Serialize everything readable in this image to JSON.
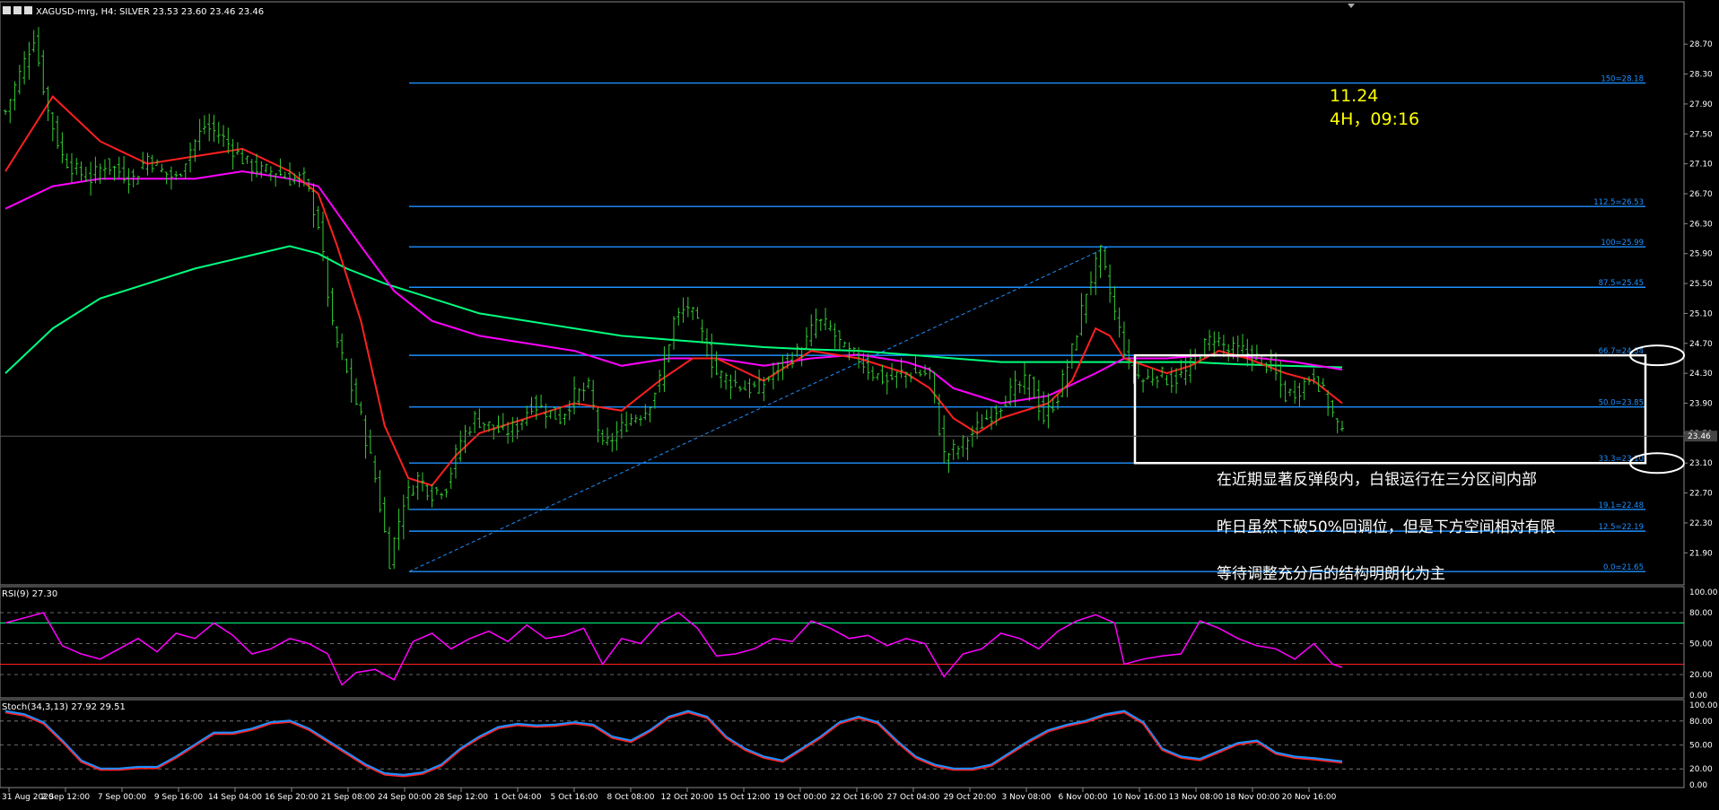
{
  "header": {
    "title": "XAGUSD-mrg, H4:  SILVER  23.53 23.60 23.46 23.46"
  },
  "note": {
    "line1": "11.24",
    "line2": "4H，09:16"
  },
  "annotations": [
    "在近期显著反弹段内，白银运行在三分区间内部",
    "昨日虽然下破50%回调位，但是下方空间相对有限",
    "等待调整充分后的结构明朗化为主"
  ],
  "price_axis": {
    "ticks": [
      "28.70",
      "28.30",
      "27.90",
      "27.50",
      "27.10",
      "26.70",
      "26.30",
      "25.90",
      "25.50",
      "25.10",
      "24.70",
      "24.30",
      "23.90",
      "23.50",
      "23.10",
      "22.70",
      "22.30",
      "21.90"
    ],
    "current": "23.46"
  },
  "x_axis": {
    "ticks": [
      "31 Aug 2020",
      "2 Sep 12:00",
      "7 Sep 00:00",
      "9 Sep 16:00",
      "14 Sep 04:00",
      "16 Sep 20:00",
      "21 Sep 08:00",
      "24 Sep 00:00",
      "28 Sep 12:00",
      "1 Oct 04:00",
      "5 Oct 16:00",
      "8 Oct 08:00",
      "12 Oct 20:00",
      "15 Oct 12:00",
      "19 Oct 00:00",
      "22 Oct 16:00",
      "27 Oct 04:00",
      "29 Oct 20:00",
      "3 Nov 08:00",
      "6 Nov 00:00",
      "10 Nov 16:00",
      "13 Nov 08:00",
      "18 Nov 00:00",
      "20 Nov 16:00"
    ]
  },
  "rsi": {
    "title": "RSI(9) 27.30",
    "ticks": [
      "100.00",
      "80.00",
      "50.00",
      "20.00",
      "0.00"
    ]
  },
  "stoch": {
    "title": "Stoch(34,3,13) 27.92 29.51",
    "ticks": [
      "100.00",
      "80.00",
      "50.00",
      "20.00",
      "0.00"
    ]
  },
  "colors": {
    "bg": "#000000",
    "candle": "#33cc33",
    "fib": "#1e90ff",
    "ma_fast": "#ff2020",
    "ma_mid": "#ff00ff",
    "ma_slow": "#00ff7f",
    "rsi": "#ff00ff",
    "stoch_main": "#1e90ff",
    "stoch_signal": "#ff2020",
    "text": "#ffffff",
    "note": "#ffff00"
  },
  "chart_data": {
    "type": "line",
    "price_range": [
      21.52,
      29.05
    ],
    "fib_levels": [
      {
        "label": "150=28.18",
        "value": 28.18
      },
      {
        "label": "112.5=26.53",
        "value": 26.53
      },
      {
        "label": "100=25.99",
        "value": 25.99
      },
      {
        "label": "87.5=25.45",
        "value": 25.45
      },
      {
        "label": "66.7=24.54",
        "value": 24.54
      },
      {
        "label": "50.0=23.85",
        "value": 23.85
      },
      {
        "label": "33.3=23.10",
        "value": 23.1
      },
      {
        "label": "19.1=22.48",
        "value": 22.48
      },
      {
        "label": "12.5=22.19",
        "value": 22.19
      },
      {
        "label": "0.0=21.65",
        "value": 21.65
      }
    ],
    "close": [
      [
        0,
        27.8
      ],
      [
        3,
        28.3
      ],
      [
        6,
        28.8
      ],
      [
        9,
        27.8
      ],
      [
        12,
        27.2
      ],
      [
        15,
        27.0
      ],
      [
        18,
        26.9
      ],
      [
        21,
        27.1
      ],
      [
        24,
        27.0
      ],
      [
        27,
        26.9
      ],
      [
        30,
        27.2
      ],
      [
        33,
        27.0
      ],
      [
        36,
        26.9
      ],
      [
        39,
        27.3
      ],
      [
        42,
        27.6
      ],
      [
        45,
        27.5
      ],
      [
        48,
        27.3
      ],
      [
        51,
        27.1
      ],
      [
        54,
        27.0
      ],
      [
        57,
        27.0
      ],
      [
        60,
        26.9
      ],
      [
        63,
        26.9
      ],
      [
        66,
        26.3
      ],
      [
        69,
        24.9
      ],
      [
        72,
        24.3
      ],
      [
        75,
        23.7
      ],
      [
        78,
        22.9
      ],
      [
        81,
        21.8
      ],
      [
        84,
        22.6
      ],
      [
        87,
        22.9
      ],
      [
        90,
        22.7
      ],
      [
        93,
        22.8
      ],
      [
        96,
        23.4
      ],
      [
        99,
        23.7
      ],
      [
        102,
        23.6
      ],
      [
        105,
        23.5
      ],
      [
        108,
        23.6
      ],
      [
        111,
        23.9
      ],
      [
        114,
        23.8
      ],
      [
        117,
        23.7
      ],
      [
        120,
        24.0
      ],
      [
        123,
        24.1
      ],
      [
        126,
        23.3
      ],
      [
        129,
        23.5
      ],
      [
        132,
        23.7
      ],
      [
        135,
        23.8
      ],
      [
        138,
        24.2
      ],
      [
        141,
        25.0
      ],
      [
        144,
        25.2
      ],
      [
        147,
        24.8
      ],
      [
        150,
        24.3
      ],
      [
        153,
        24.2
      ],
      [
        156,
        24.1
      ],
      [
        159,
        24.1
      ],
      [
        162,
        24.3
      ],
      [
        165,
        24.5
      ],
      [
        168,
        24.6
      ],
      [
        171,
        25.0
      ],
      [
        174,
        24.9
      ],
      [
        177,
        24.6
      ],
      [
        180,
        24.5
      ],
      [
        183,
        24.3
      ],
      [
        186,
        24.2
      ],
      [
        189,
        24.3
      ],
      [
        192,
        24.3
      ],
      [
        195,
        24.3
      ],
      [
        198,
        23.2
      ],
      [
        201,
        23.3
      ],
      [
        204,
        23.5
      ],
      [
        207,
        23.7
      ],
      [
        210,
        23.9
      ],
      [
        213,
        24.1
      ],
      [
        216,
        24.2
      ],
      [
        219,
        23.7
      ],
      [
        222,
        24.0
      ],
      [
        225,
        24.6
      ],
      [
        228,
        25.4
      ],
      [
        231,
        25.9
      ],
      [
        234,
        25.1
      ],
      [
        237,
        24.4
      ],
      [
        240,
        24.2
      ],
      [
        243,
        24.3
      ],
      [
        246,
        24.2
      ],
      [
        249,
        24.3
      ],
      [
        252,
        24.6
      ],
      [
        255,
        24.8
      ],
      [
        258,
        24.6
      ],
      [
        261,
        24.6
      ],
      [
        264,
        24.5
      ],
      [
        267,
        24.4
      ],
      [
        270,
        24.0
      ],
      [
        273,
        24.1
      ],
      [
        276,
        24.3
      ],
      [
        279,
        23.9
      ],
      [
        282,
        23.46
      ]
    ],
    "ma_fast": [
      [
        0,
        27.0
      ],
      [
        10,
        28.0
      ],
      [
        20,
        27.4
      ],
      [
        30,
        27.1
      ],
      [
        40,
        27.2
      ],
      [
        50,
        27.3
      ],
      [
        60,
        27.0
      ],
      [
        66,
        26.7
      ],
      [
        70,
        26.0
      ],
      [
        75,
        25.0
      ],
      [
        80,
        23.6
      ],
      [
        85,
        22.9
      ],
      [
        90,
        22.8
      ],
      [
        95,
        23.2
      ],
      [
        100,
        23.5
      ],
      [
        110,
        23.7
      ],
      [
        120,
        23.9
      ],
      [
        130,
        23.8
      ],
      [
        138,
        24.2
      ],
      [
        145,
        24.5
      ],
      [
        150,
        24.5
      ],
      [
        160,
        24.2
      ],
      [
        170,
        24.6
      ],
      [
        180,
        24.5
      ],
      [
        190,
        24.3
      ],
      [
        195,
        24.1
      ],
      [
        200,
        23.7
      ],
      [
        205,
        23.5
      ],
      [
        210,
        23.7
      ],
      [
        220,
        23.9
      ],
      [
        225,
        24.2
      ],
      [
        230,
        24.9
      ],
      [
        233,
        24.8
      ],
      [
        236,
        24.5
      ],
      [
        245,
        24.3
      ],
      [
        250,
        24.4
      ],
      [
        256,
        24.6
      ],
      [
        262,
        24.5
      ],
      [
        270,
        24.3
      ],
      [
        276,
        24.2
      ],
      [
        282,
        23.9
      ]
    ],
    "ma_mid": [
      [
        0,
        26.5
      ],
      [
        10,
        26.8
      ],
      [
        20,
        26.9
      ],
      [
        30,
        26.9
      ],
      [
        40,
        26.9
      ],
      [
        50,
        27.0
      ],
      [
        60,
        26.9
      ],
      [
        66,
        26.8
      ],
      [
        75,
        26.0
      ],
      [
        82,
        25.4
      ],
      [
        90,
        25.0
      ],
      [
        100,
        24.8
      ],
      [
        110,
        24.7
      ],
      [
        120,
        24.6
      ],
      [
        130,
        24.4
      ],
      [
        140,
        24.5
      ],
      [
        150,
        24.5
      ],
      [
        160,
        24.4
      ],
      [
        170,
        24.5
      ],
      [
        180,
        24.55
      ],
      [
        190,
        24.45
      ],
      [
        195,
        24.35
      ],
      [
        200,
        24.1
      ],
      [
        210,
        23.9
      ],
      [
        220,
        24.0
      ],
      [
        230,
        24.3
      ],
      [
        236,
        24.5
      ],
      [
        245,
        24.5
      ],
      [
        255,
        24.55
      ],
      [
        265,
        24.5
      ],
      [
        272,
        24.45
      ],
      [
        282,
        24.35
      ]
    ],
    "ma_slow": [
      [
        0,
        24.3
      ],
      [
        10,
        24.9
      ],
      [
        20,
        25.3
      ],
      [
        30,
        25.5
      ],
      [
        40,
        25.7
      ],
      [
        50,
        25.85
      ],
      [
        60,
        26.0
      ],
      [
        66,
        25.9
      ],
      [
        72,
        25.7
      ],
      [
        80,
        25.5
      ],
      [
        90,
        25.3
      ],
      [
        100,
        25.1
      ],
      [
        110,
        25.0
      ],
      [
        120,
        24.9
      ],
      [
        130,
        24.8
      ],
      [
        140,
        24.75
      ],
      [
        150,
        24.7
      ],
      [
        160,
        24.65
      ],
      [
        170,
        24.62
      ],
      [
        180,
        24.6
      ],
      [
        190,
        24.55
      ],
      [
        200,
        24.5
      ],
      [
        210,
        24.45
      ],
      [
        220,
        24.45
      ],
      [
        230,
        24.45
      ],
      [
        240,
        24.45
      ],
      [
        250,
        24.45
      ],
      [
        260,
        24.42
      ],
      [
        270,
        24.4
      ],
      [
        282,
        24.38
      ]
    ],
    "rsi_values": [
      [
        0,
        70
      ],
      [
        4,
        75
      ],
      [
        8,
        80
      ],
      [
        12,
        48
      ],
      [
        16,
        40
      ],
      [
        20,
        35
      ],
      [
        24,
        45
      ],
      [
        28,
        55
      ],
      [
        32,
        42
      ],
      [
        36,
        60
      ],
      [
        40,
        55
      ],
      [
        44,
        70
      ],
      [
        48,
        58
      ],
      [
        52,
        40
      ],
      [
        56,
        45
      ],
      [
        60,
        55
      ],
      [
        64,
        50
      ],
      [
        68,
        40
      ],
      [
        71,
        10
      ],
      [
        74,
        22
      ],
      [
        78,
        25
      ],
      [
        82,
        15
      ],
      [
        86,
        52
      ],
      [
        90,
        60
      ],
      [
        94,
        45
      ],
      [
        98,
        55
      ],
      [
        102,
        62
      ],
      [
        106,
        52
      ],
      [
        110,
        68
      ],
      [
        114,
        55
      ],
      [
        118,
        58
      ],
      [
        122,
        65
      ],
      [
        126,
        30
      ],
      [
        130,
        55
      ],
      [
        134,
        50
      ],
      [
        138,
        70
      ],
      [
        142,
        80
      ],
      [
        146,
        65
      ],
      [
        150,
        38
      ],
      [
        154,
        40
      ],
      [
        158,
        45
      ],
      [
        162,
        55
      ],
      [
        166,
        52
      ],
      [
        170,
        72
      ],
      [
        174,
        65
      ],
      [
        178,
        55
      ],
      [
        182,
        58
      ],
      [
        186,
        48
      ],
      [
        190,
        55
      ],
      [
        194,
        50
      ],
      [
        198,
        18
      ],
      [
        202,
        40
      ],
      [
        206,
        45
      ],
      [
        210,
        60
      ],
      [
        214,
        55
      ],
      [
        218,
        45
      ],
      [
        222,
        62
      ],
      [
        226,
        72
      ],
      [
        230,
        78
      ],
      [
        234,
        70
      ],
      [
        236,
        30
      ],
      [
        240,
        35
      ],
      [
        244,
        38
      ],
      [
        248,
        40
      ],
      [
        252,
        72
      ],
      [
        256,
        65
      ],
      [
        260,
        55
      ],
      [
        264,
        48
      ],
      [
        268,
        45
      ],
      [
        272,
        35
      ],
      [
        276,
        50
      ],
      [
        280,
        30
      ],
      [
        282,
        27
      ]
    ],
    "stoch_values": [
      [
        0,
        92
      ],
      [
        4,
        88
      ],
      [
        8,
        78
      ],
      [
        12,
        55
      ],
      [
        16,
        30
      ],
      [
        20,
        20
      ],
      [
        24,
        20
      ],
      [
        28,
        22
      ],
      [
        32,
        22
      ],
      [
        36,
        35
      ],
      [
        40,
        50
      ],
      [
        44,
        65
      ],
      [
        48,
        65
      ],
      [
        52,
        70
      ],
      [
        56,
        78
      ],
      [
        60,
        80
      ],
      [
        64,
        70
      ],
      [
        68,
        55
      ],
      [
        72,
        40
      ],
      [
        76,
        25
      ],
      [
        80,
        14
      ],
      [
        84,
        12
      ],
      [
        88,
        15
      ],
      [
        92,
        25
      ],
      [
        96,
        45
      ],
      [
        100,
        60
      ],
      [
        104,
        72
      ],
      [
        108,
        76
      ],
      [
        112,
        74
      ],
      [
        116,
        75
      ],
      [
        120,
        78
      ],
      [
        124,
        75
      ],
      [
        128,
        60
      ],
      [
        132,
        55
      ],
      [
        136,
        68
      ],
      [
        140,
        85
      ],
      [
        144,
        92
      ],
      [
        148,
        85
      ],
      [
        152,
        60
      ],
      [
        156,
        45
      ],
      [
        160,
        35
      ],
      [
        164,
        30
      ],
      [
        168,
        45
      ],
      [
        172,
        60
      ],
      [
        176,
        78
      ],
      [
        180,
        85
      ],
      [
        184,
        78
      ],
      [
        188,
        55
      ],
      [
        192,
        35
      ],
      [
        196,
        25
      ],
      [
        200,
        20
      ],
      [
        204,
        20
      ],
      [
        208,
        25
      ],
      [
        212,
        40
      ],
      [
        216,
        55
      ],
      [
        220,
        68
      ],
      [
        224,
        75
      ],
      [
        228,
        80
      ],
      [
        232,
        88
      ],
      [
        236,
        92
      ],
      [
        240,
        78
      ],
      [
        244,
        45
      ],
      [
        248,
        35
      ],
      [
        252,
        32
      ],
      [
        256,
        42
      ],
      [
        260,
        52
      ],
      [
        264,
        55
      ],
      [
        268,
        40
      ],
      [
        272,
        35
      ],
      [
        276,
        33
      ],
      [
        282,
        29
      ]
    ]
  }
}
